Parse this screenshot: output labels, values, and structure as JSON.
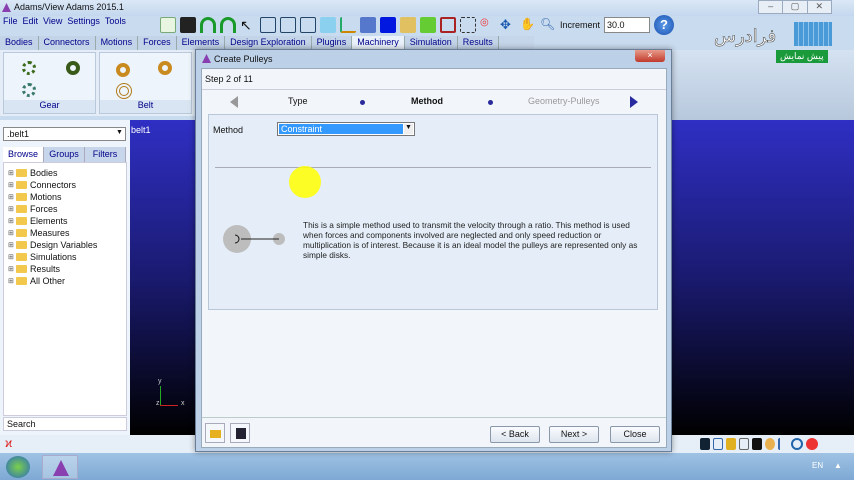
{
  "app": {
    "title": "Adams/View Adams 2015.1",
    "window_controls": [
      "–",
      "▢",
      "✕"
    ]
  },
  "menu": [
    "File",
    "Edit",
    "View",
    "Settings",
    "Tools"
  ],
  "toolbar": {
    "increment_label": "Increment",
    "increment_value": "30.0",
    "help": "?"
  },
  "ribbon_tabs": [
    "Bodies",
    "Connectors",
    "Motions",
    "Forces",
    "Elements",
    "Design Exploration",
    "Plugins",
    "Machinery",
    "Simulation",
    "Results"
  ],
  "ribbon_active": "Machinery",
  "ribbon_groups": [
    {
      "label": "Gear"
    },
    {
      "label": "Belt"
    }
  ],
  "logo": {
    "text": "فرادرس",
    "badge": "پیش نمایش"
  },
  "browser": {
    "selected": ".belt1",
    "tabs": [
      "Browse",
      "Groups",
      "Filters"
    ],
    "tree": [
      "Bodies",
      "Connectors",
      "Motions",
      "Forces",
      "Elements",
      "Measures",
      "Design Variables",
      "Simulations",
      "Results",
      "All Other"
    ],
    "search": "Search"
  },
  "viewport": {
    "label": "belt1",
    "axes": {
      "y": "y",
      "z": "z",
      "x": "x"
    }
  },
  "dialog": {
    "title": "Create Pulleys",
    "step": "Step 2 of 11",
    "steps": {
      "prev": "Type",
      "current": "Method",
      "next": "Geometry-Pulleys"
    },
    "method_label": "Method",
    "method_value": "Constraint",
    "description": "This is a simple method used to transmit the velocity through a ratio. This method is used when forces and components involved are neglected and only speed reduction or multiplication is of interest. Because it is an ideal model the pulleys are represented only as simple disks.",
    "buttons": {
      "back": "< Back",
      "next": "Next >",
      "close": "Close"
    },
    "close_x": "×"
  },
  "taskbar": {
    "lang": "EN"
  }
}
